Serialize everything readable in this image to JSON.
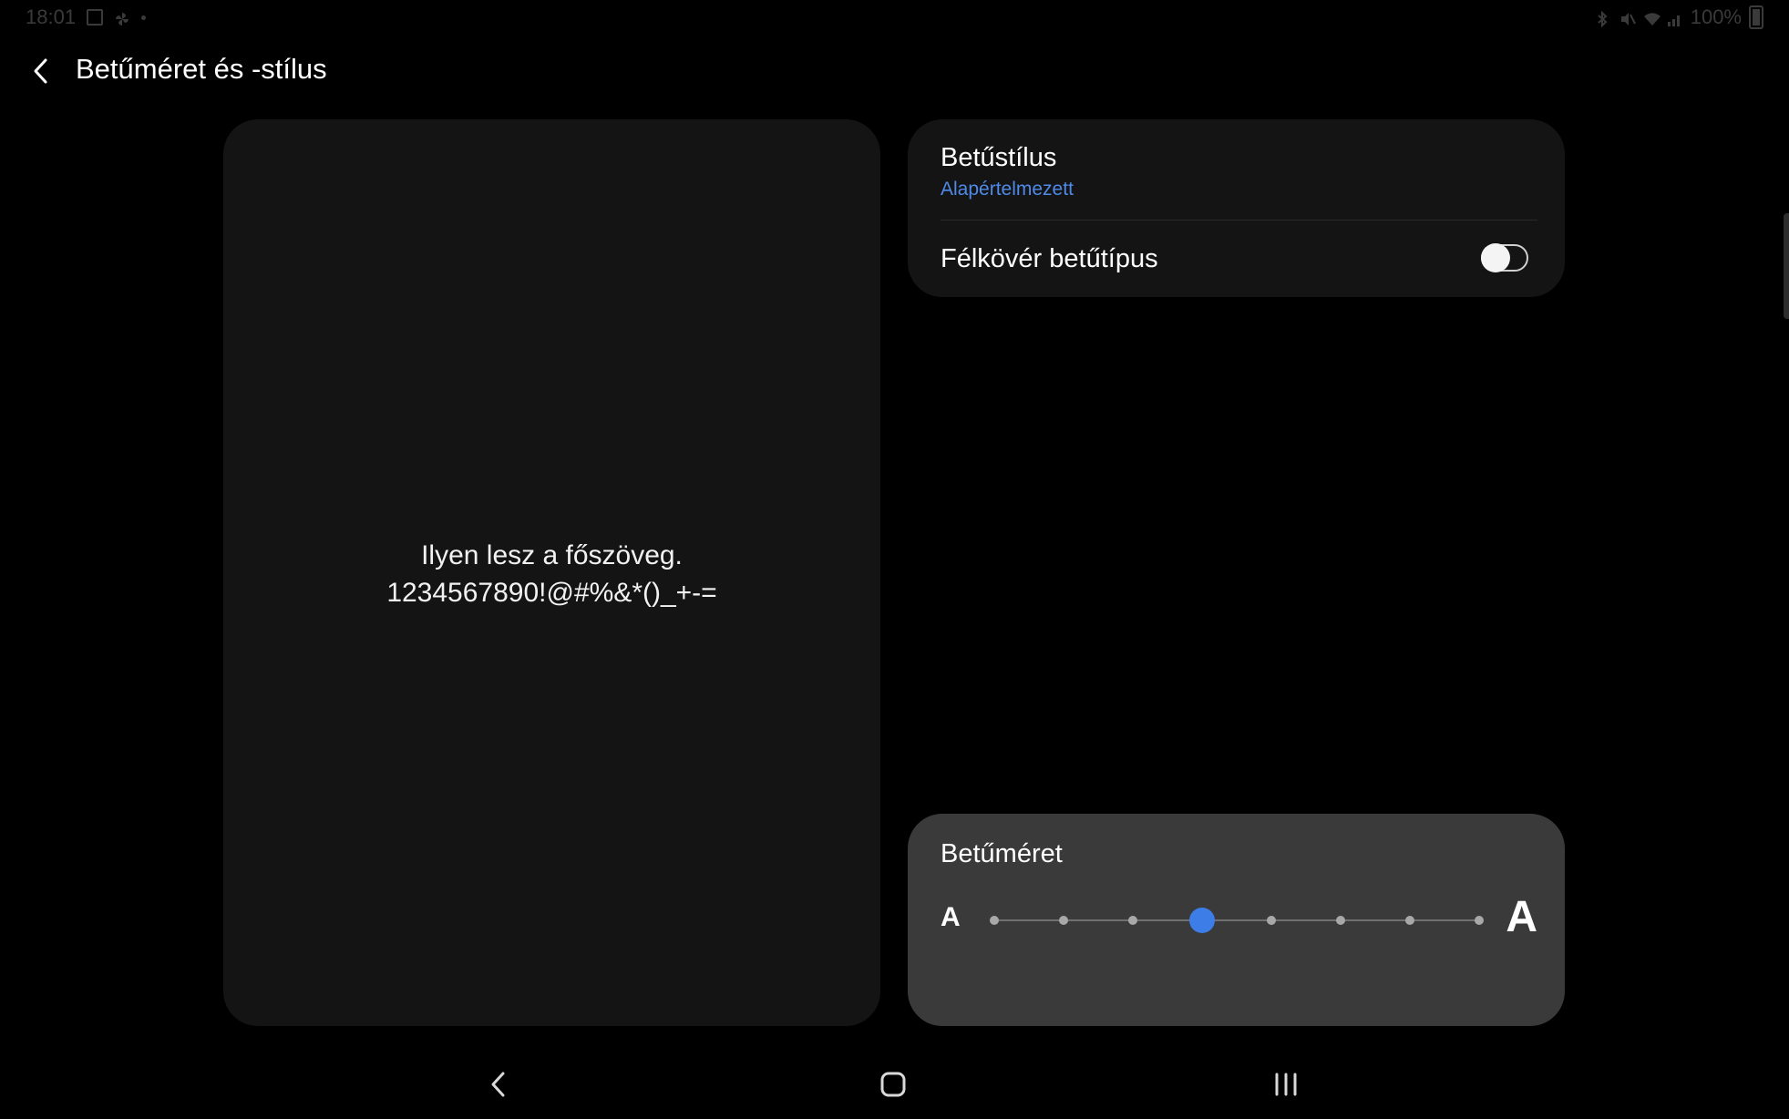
{
  "status_bar": {
    "time": "18:01",
    "battery_text": "100%"
  },
  "header": {
    "title": "Betűméret és -stílus"
  },
  "preview": {
    "line1": "Ilyen lesz a főszöveg.",
    "line2": "1234567890!@#%&*()_+-="
  },
  "font_style": {
    "label": "Betűstílus",
    "value": "Alapértelmezett"
  },
  "bold_font": {
    "label": "Félkövér betűtípus",
    "enabled": false
  },
  "font_size": {
    "title": "Betűméret",
    "small_glyph": "A",
    "large_glyph": "A",
    "steps": 8,
    "selected_step": 4
  },
  "colors": {
    "accent": "#3d7de8",
    "link": "#4f8ae8",
    "card_bg": "#141414",
    "size_card_bg": "#3a3a3a"
  },
  "icons": {
    "back": "chevron-left-icon",
    "nav_back": "nav-back-icon",
    "nav_home": "nav-home-icon",
    "nav_recents": "nav-recents-icon"
  }
}
